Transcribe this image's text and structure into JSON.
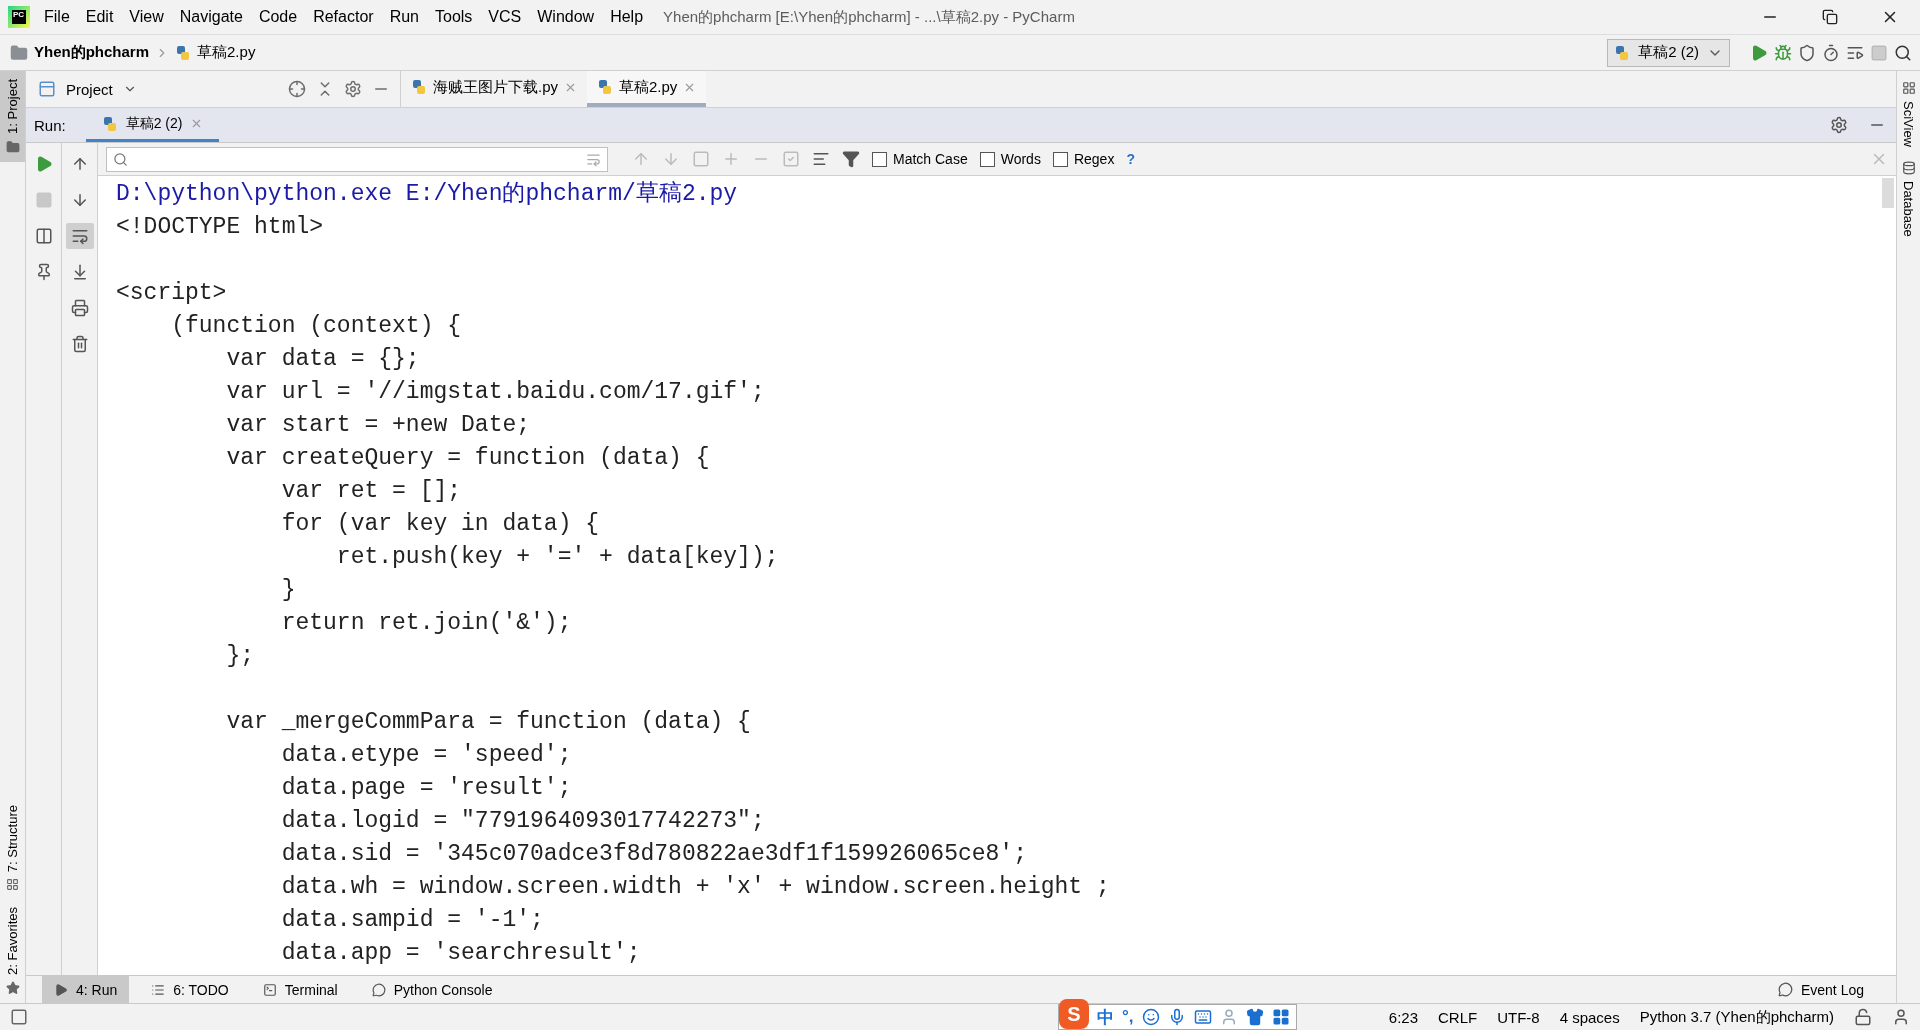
{
  "title_bar": {
    "logo": "PC",
    "menu": [
      "File",
      "Edit",
      "View",
      "Navigate",
      "Code",
      "Refactor",
      "Run",
      "Tools",
      "VCS",
      "Window",
      "Help"
    ],
    "title": "Yhen的phcharm [E:\\Yhen的phcharm] - ...\\草稿2.py - PyCharm"
  },
  "nav_bar": {
    "breadcrumbs": [
      "Yhen的phcharm",
      "草稿2.py"
    ],
    "run_config": "草稿2 (2)"
  },
  "left_stripe": [
    {
      "label": "1: Project",
      "selected": true
    },
    {
      "label": "7: Structure",
      "selected": false
    },
    {
      "label": "2: Favorites",
      "selected": false
    }
  ],
  "project_panel": {
    "title": "Project"
  },
  "editor_tabs": [
    {
      "label": "海贼王图片下载.py",
      "selected": false
    },
    {
      "label": "草稿2.py",
      "selected": true
    }
  ],
  "right_stripe": [
    "SciView",
    "Database"
  ],
  "run_panel": {
    "label": "Run:",
    "tabs": [
      {
        "label": "草稿2 (2)",
        "selected": true
      }
    ],
    "soft_wrap": true,
    "options": [
      {
        "label": "Match Case",
        "checked": false
      },
      {
        "label": "Words",
        "checked": false
      },
      {
        "label": "Regex",
        "checked": false
      }
    ],
    "help": "?"
  },
  "console": {
    "lines": [
      {
        "kind": "command",
        "text": "D:\\python\\python.exe E:/Yhen的phcharm/草稿2.py"
      },
      {
        "kind": "output",
        "text": "<!DOCTYPE html>"
      },
      {
        "kind": "blank"
      },
      {
        "kind": "output",
        "text": "<script>"
      },
      {
        "kind": "output",
        "text": "    (function (context) {"
      },
      {
        "kind": "output",
        "text": "        var data = {};"
      },
      {
        "kind": "output",
        "text": "        var url = '//imgstat.baidu.com/17.gif';"
      },
      {
        "kind": "output",
        "text": "        var start = +new Date;"
      },
      {
        "kind": "output",
        "text": "        var createQuery = function (data) {"
      },
      {
        "kind": "output",
        "text": "            var ret = [];"
      },
      {
        "kind": "output",
        "text": "            for (var key in data) {"
      },
      {
        "kind": "output",
        "text": "                ret.push(key + '=' + data[key]);"
      },
      {
        "kind": "output",
        "text": "            }"
      },
      {
        "kind": "output",
        "text": "            return ret.join('&');"
      },
      {
        "kind": "output",
        "text": "        };"
      },
      {
        "kind": "blank"
      },
      {
        "kind": "output",
        "text": "        var _mergeCommPara = function (data) {"
      },
      {
        "kind": "output",
        "text": "            data.etype = 'speed';"
      },
      {
        "kind": "output",
        "text": "            data.page = 'result';"
      },
      {
        "kind": "output",
        "text": "            data.logid = \"7791964093017742273\";"
      },
      {
        "kind": "output",
        "text": "            data.sid = '345c070adce3f8d780822ae3df1f159926065ce8';"
      },
      {
        "kind": "output",
        "text": "            data.wh = window.screen.width + 'x' + window.screen.height ;"
      },
      {
        "kind": "output",
        "text": "            data.sampid = '-1';"
      },
      {
        "kind": "output",
        "text": "            data.app = 'searchresult';"
      }
    ]
  },
  "tool_tabs": [
    {
      "label": "4: Run",
      "selected": true
    },
    {
      "label": "6: TODO",
      "selected": false
    },
    {
      "label": "Terminal",
      "selected": false
    },
    {
      "label": "Python Console",
      "selected": false
    }
  ],
  "event_log": "Event Log",
  "ime_bar": {
    "logo": "S",
    "mode": "中",
    "punctuation": "°,"
  },
  "status_bar": [
    "6:23",
    "CRLF",
    "UTF-8",
    "4 spaces",
    "Python 3.7 (Yhen的phcharm)"
  ]
}
